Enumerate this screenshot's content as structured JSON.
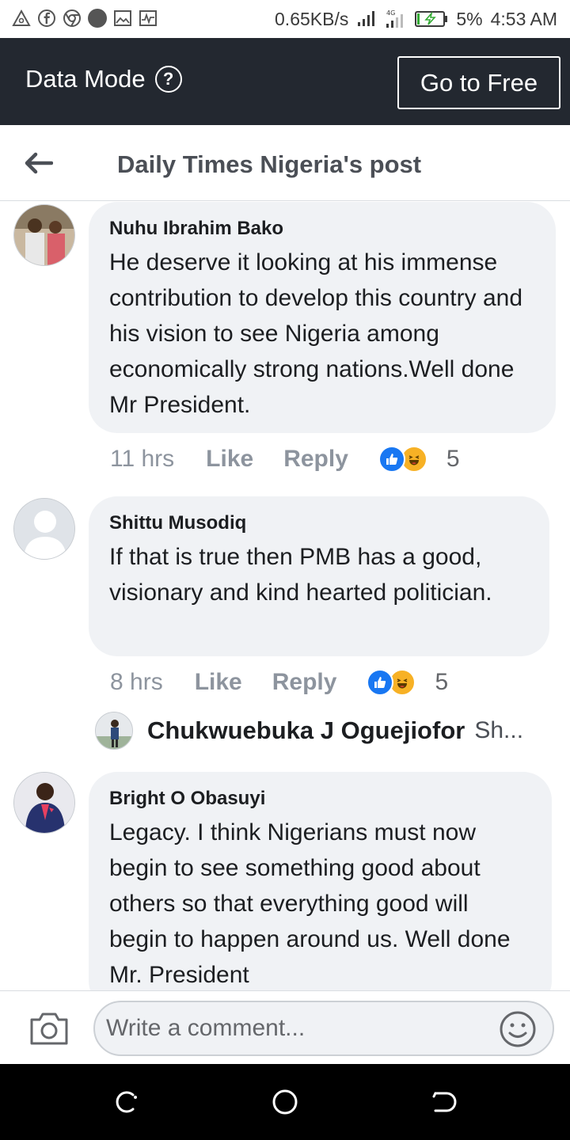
{
  "status_bar": {
    "network_speed": "0.65KB/s",
    "battery": "5%",
    "time": "4:53 AM"
  },
  "data_mode": {
    "label": "Data Mode",
    "help_glyph": "?",
    "go_free_label": "Go to Free"
  },
  "header": {
    "title": "Daily Times Nigeria's post"
  },
  "comments": [
    {
      "author": "Nuhu Ibrahim Bako",
      "text": "He deserve it looking at his immense contribution to develop this country and his vision to see Nigeria among economically strong nations.Well done Mr President.",
      "time": "11 hrs",
      "like_label": "Like",
      "reply_label": "Reply",
      "reaction_count": "5"
    },
    {
      "author": "Shittu Musodiq",
      "text": "If that is true then PMB has a good, visionary and kind hearted politician.",
      "time": "8 hrs",
      "like_label": "Like",
      "reply_label": "Reply",
      "reaction_count": "5",
      "reply_preview": {
        "name": "Chukwuebuka J Oguejiofor",
        "snippet": "Sh..."
      }
    },
    {
      "author": "Bright O Obasuyi",
      "text": "Legacy. I think Nigerians must now begin to see something good about others so that everything good will begin to happen around us. Well done Mr. President"
    }
  ],
  "composer": {
    "placeholder": "Write a comment..."
  },
  "icons": {
    "back": "arrow-left-icon",
    "camera": "camera-icon",
    "emoji": "smiley-icon",
    "like_reaction": "thumbs-up-icon",
    "haha_reaction": "laughing-face-icon"
  },
  "colors": {
    "data_mode_bar": "#232830",
    "bubble": "#f0f2f5",
    "like_blue": "#1877f2",
    "haha_yellow": "#f7b125"
  }
}
